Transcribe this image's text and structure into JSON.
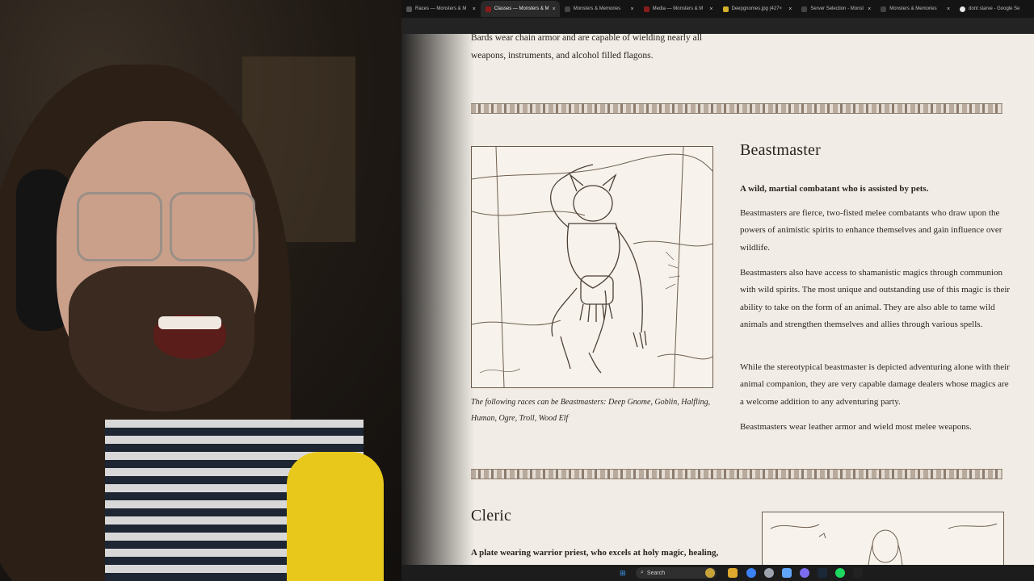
{
  "browser": {
    "tabs": [
      {
        "label": "Races — Monsters & M",
        "active": false
      },
      {
        "label": "Classes — Monsters & M",
        "active": true
      },
      {
        "label": "Monsters & Memories",
        "active": false
      },
      {
        "label": "Media — Monsters & M",
        "active": false
      },
      {
        "label": "Deepgnomes.jpg (427×",
        "active": false
      },
      {
        "label": "Server Selection - Monst",
        "active": false
      },
      {
        "label": "Monsters & Memories",
        "active": false
      },
      {
        "label": "dont starve - Google Se",
        "active": false
      }
    ],
    "close_glyph": "×"
  },
  "page": {
    "intro_text": "Bards wear chain armor and are capable of wielding nearly all weapons, instruments, and alcohol filled flagons.",
    "beastmaster": {
      "title": "Beastmaster",
      "tagline": "A wild, martial combatant who is assisted by pets.",
      "paragraphs": [
        "Beastmasters are fierce, two-fisted melee combatants who draw upon the powers of animistic spirits to enhance themselves and gain influence over wildlife.",
        "Beastmasters also have access to shamanistic magics through communion with wild spirits. The most unique and outstanding use of this magic is their ability to take on the form of an animal. They are also able to tame wild animals and strengthen themselves and allies through various spells.",
        "While the stereotypical beastmaster is depicted adventuring alone with their animal companion, they are very capable damage dealers whose magics are a welcome addition to any adventuring party.",
        "Beastmasters wear leather armor and wield most melee weapons."
      ],
      "caption": "The following races can be Beastmasters: Deep Gnome, Goblin, Halfling, Human, Ogre, Troll, Wood Elf"
    },
    "cleric": {
      "title": "Cleric",
      "tagline": "A plate wearing warrior priest, who excels at holy magic, healing,"
    }
  },
  "taskbar": {
    "search_label": "Search"
  }
}
